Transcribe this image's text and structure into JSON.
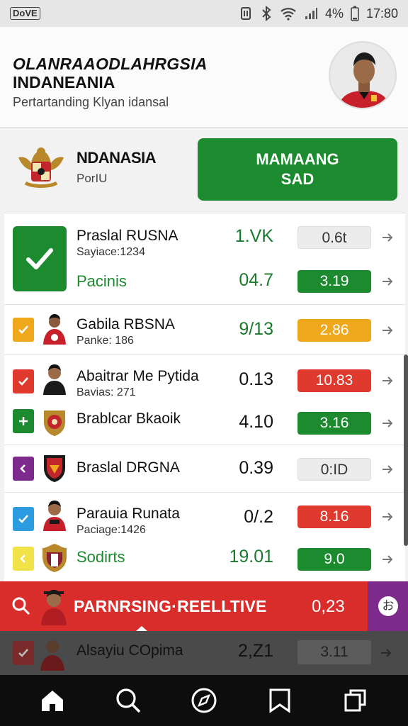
{
  "status_bar": {
    "carrier": "DoVE",
    "battery": "4%",
    "time": "17:80"
  },
  "header": {
    "title_line1": "OLANRAAODLAHRGSIA",
    "title_line2": "INDANEANIA",
    "subtitle": "Pertartanding Klyan idansal"
  },
  "team": {
    "name": "NDANASIA",
    "sub": "PorIU",
    "cta_line1": "MAMAANG",
    "cta_line2": "SAD"
  },
  "rows": [
    {
      "name": "Praslal RUSNA",
      "sub": "Sayiace:1234",
      "value": "1.VK",
      "pill": "0.6t",
      "pill_style": "gray",
      "value_color": "green"
    },
    {
      "name": "Pacinis",
      "sub": "",
      "value": "04.7",
      "pill": "3.19",
      "pill_style": "green",
      "value_color": "green"
    },
    {
      "name": "Gabila RBSNA",
      "sub": "Panke: 186",
      "value": "9/13",
      "pill": "2.86",
      "pill_style": "yellow",
      "value_color": "green"
    },
    {
      "name": "Abaitrar Me Pytida",
      "sub": "Bavias: 271",
      "value": "0.13",
      "pill": "10.83",
      "pill_style": "red",
      "value_color": "dark"
    },
    {
      "name": "Brablcar Bkaoik",
      "sub": "",
      "value": "4.10",
      "pill": "3.16",
      "pill_style": "green",
      "value_color": "dark"
    },
    {
      "name": "Braslal DRGNA",
      "sub": "",
      "value": "0.39",
      "pill": "0:ID",
      "pill_style": "gray",
      "value_color": "dark"
    },
    {
      "name": "Parauia Runata",
      "sub": "Paciage:1426",
      "value": "0/.2",
      "pill": "8.16",
      "pill_style": "red",
      "value_color": "dark"
    },
    {
      "name": "Sodirts",
      "sub": "",
      "value": "19.01",
      "pill": "9.0",
      "pill_style": "green",
      "value_color": "green"
    }
  ],
  "search_bar": {
    "text": "PARNRSING·REELLTIVE",
    "value": "0,23",
    "side_icon": "お"
  },
  "dim_row": {
    "name": "Alsayiu COpima",
    "value": "2,Z1",
    "pill": "3.11"
  },
  "nav": [
    "home-icon",
    "search-icon",
    "compass-icon",
    "bookmark-icon",
    "tabs-icon"
  ],
  "colors": {
    "green": "#1c8a2e",
    "red": "#e03a2f",
    "yellow": "#efa81c",
    "purple": "#7d2a8c"
  }
}
